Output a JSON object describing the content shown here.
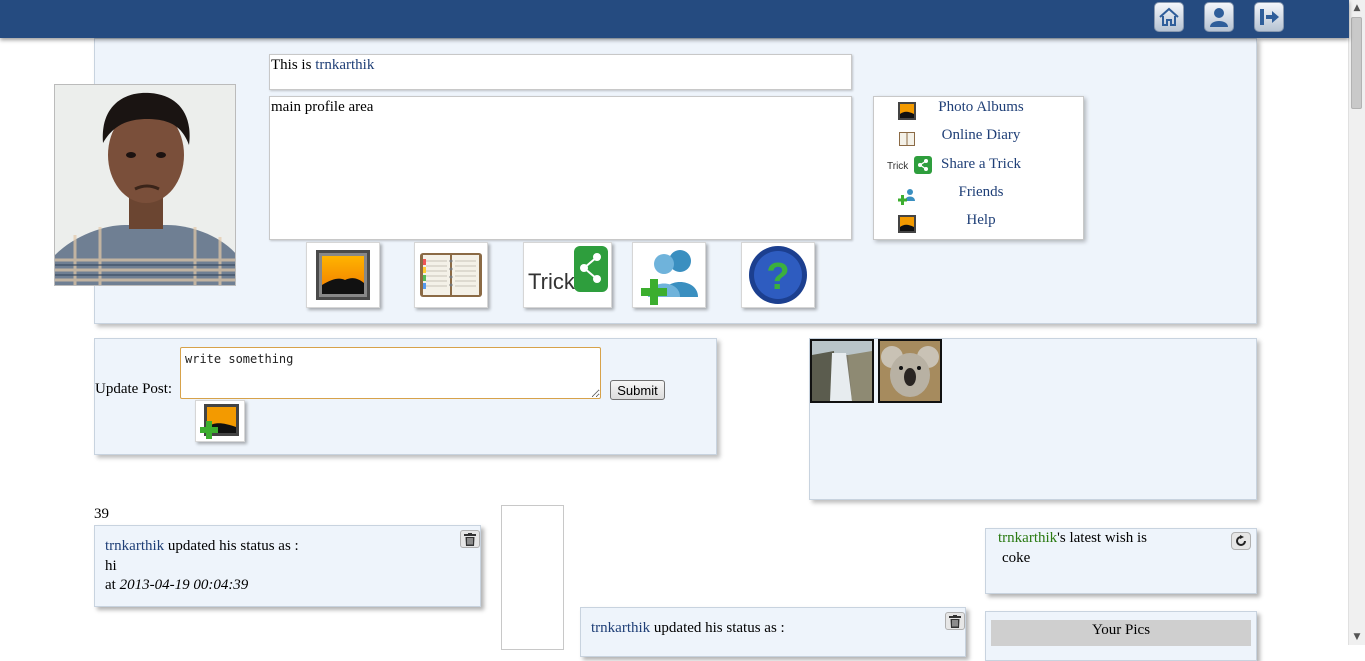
{
  "profile": {
    "this_is_prefix": "This is ",
    "username": "trnkarthik",
    "main_area_text": "main profile area"
  },
  "menu": {
    "items": [
      {
        "label": "Photo Albums",
        "icon": "photo-album-icon"
      },
      {
        "label": "Online Diary",
        "icon": "diary-icon"
      },
      {
        "label": "Share a Trick",
        "icon": "share-trick-icon",
        "prefix": "Trick"
      },
      {
        "label": "Friends",
        "icon": "add-friend-icon"
      },
      {
        "label": "Help",
        "icon": "help-icon"
      }
    ]
  },
  "tiles": {
    "trick_text": "Trick"
  },
  "update_post": {
    "label": "Update Post:",
    "placeholder": "write something",
    "submit_label": "Submit"
  },
  "count": "39",
  "status_1": {
    "user": "trnkarthik",
    "text": " updated his status as :",
    "message": "hi",
    "at_label": "at ",
    "timestamp": "2013-04-19 00:04:39"
  },
  "status_2": {
    "user": "trnkarthik",
    "text": " updated his status as :"
  },
  "wish": {
    "user": "trnkarthik",
    "suffix": "'s latest wish is",
    "value": "coke"
  },
  "your_pics": {
    "title": "Your Pics"
  },
  "colors": {
    "topbar": "#254b80",
    "panel": "#eef4fb",
    "link": "#1f3f77",
    "wish_user": "#2a7a12"
  }
}
